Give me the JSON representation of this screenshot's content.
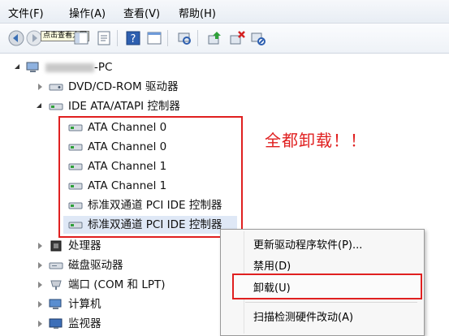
{
  "menubar": {
    "file": "文件(F)",
    "action": "操作(A)",
    "view": "查看(V)",
    "help": "帮助(H)"
  },
  "toolbar": {
    "tooltip": "点击查看大图"
  },
  "tree": {
    "root": "-PC",
    "items": [
      {
        "label": "DVD/CD-ROM 驱动器"
      },
      {
        "label": "IDE ATA/ATAPI 控制器"
      },
      {
        "label": "ATA Channel 0"
      },
      {
        "label": "ATA Channel 0"
      },
      {
        "label": "ATA Channel 1"
      },
      {
        "label": "ATA Channel 1"
      },
      {
        "label": "标准双通道 PCI IDE 控制器"
      },
      {
        "label": "标准双通道 PCI IDE 控制器"
      },
      {
        "label": "处理器"
      },
      {
        "label": "磁盘驱动器"
      },
      {
        "label": "端口 (COM 和 LPT)"
      },
      {
        "label": "计算机"
      },
      {
        "label": "监视器"
      }
    ]
  },
  "annotation": "全都卸载！！",
  "context_menu": {
    "update": "更新驱动程序软件(P)...",
    "disable": "禁用(D)",
    "uninstall": "卸载(U)",
    "scan": "扫描检测硬件改动(A)"
  },
  "colors": {
    "highlight": "#e02020",
    "menu_bg": "#f7f7f7"
  }
}
